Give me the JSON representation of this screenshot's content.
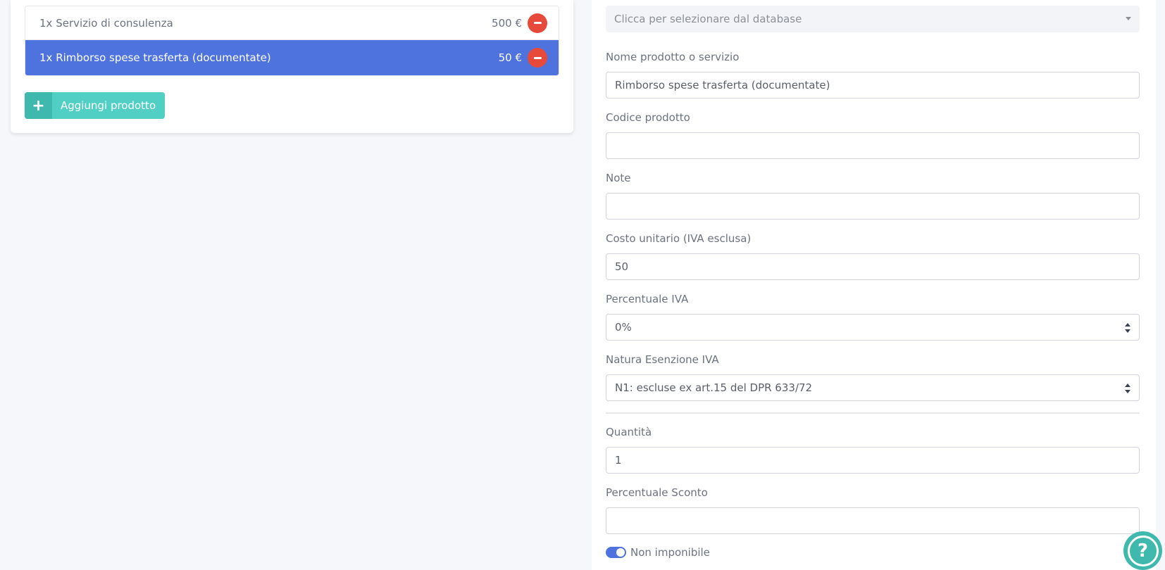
{
  "products": [
    {
      "name": "1x Servizio di consulenza",
      "price": "500 €",
      "selected": false
    },
    {
      "name": "1x Rimborso spese trasferta (documentate)",
      "price": "50 €",
      "selected": true
    }
  ],
  "add_product_label": "Aggiungi prodotto",
  "form": {
    "db_select_placeholder": "Clicca per selezionare dal database",
    "name_label": "Nome prodotto o servizio",
    "name_value": "Rimborso spese trasferta (documentate)",
    "code_label": "Codice prodotto",
    "code_value": "",
    "note_label": "Note",
    "note_value": "",
    "unit_cost_label": "Costo unitario (IVA esclusa)",
    "unit_cost_value": "50",
    "vat_label": "Percentuale IVA",
    "vat_value": "0%",
    "exemption_label": "Natura Esenzione IVA",
    "exemption_value": "N1: escluse ex art.15 del DPR 633/72",
    "quantity_label": "Quantità",
    "quantity_value": "1",
    "discount_label": "Percentuale Sconto",
    "discount_value": "",
    "non_taxable_label": "Non imponibile",
    "non_taxable_checked": true
  },
  "colors": {
    "primary": "#4e73df",
    "danger": "#e74a3b",
    "teal": "#4fd1c5"
  },
  "icons": {
    "remove": "minus-circle-icon",
    "add": "plus-icon",
    "help": "question-circle-icon"
  }
}
